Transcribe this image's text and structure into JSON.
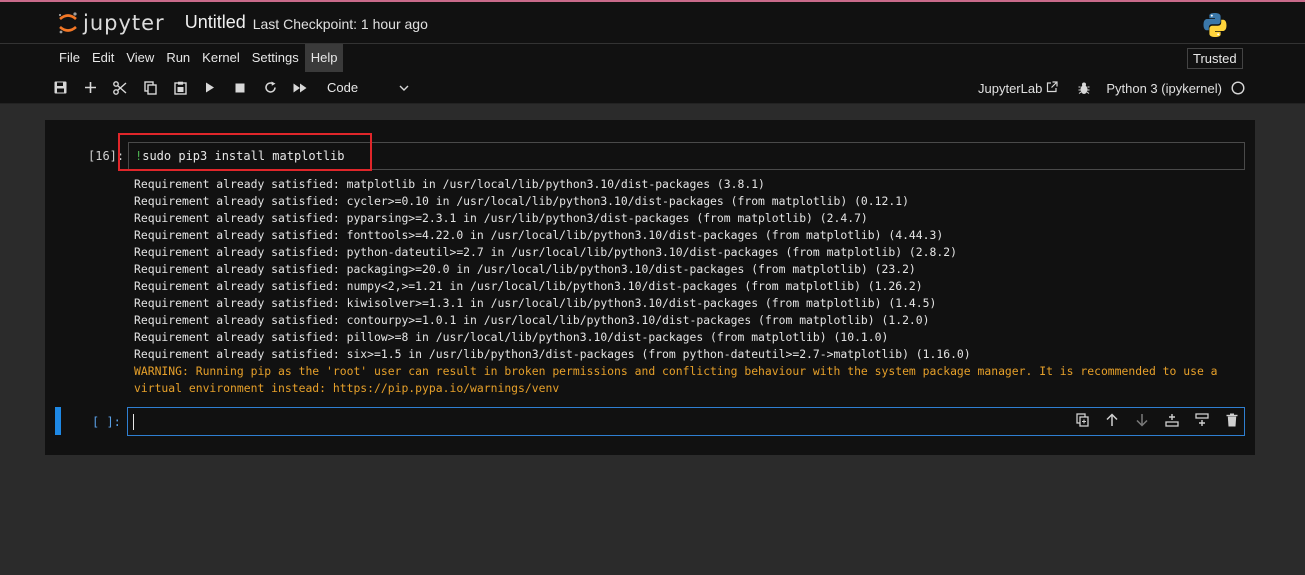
{
  "header": {
    "logo_text": "jupyter",
    "notebook_title": "Untitled",
    "checkpoint": "Last Checkpoint: 1 hour ago",
    "python_logo_icon": "python-logo-icon"
  },
  "menu": {
    "items": [
      "File",
      "Edit",
      "View",
      "Run",
      "Kernel",
      "Settings",
      "Help"
    ],
    "active": "Help",
    "trusted_label": "Trusted"
  },
  "toolbar": {
    "icons": [
      "save-icon",
      "add-icon",
      "cut-icon",
      "copy-icon",
      "paste-icon",
      "run-icon",
      "stop-icon",
      "restart-icon",
      "fast-forward-icon"
    ],
    "cell_type": "Code",
    "jupyterlab_label": "JupyterLab",
    "kernel_label": "Python 3 (ipykernel)",
    "kernel_status": "idle"
  },
  "cells": [
    {
      "prompt": "[16]:",
      "code_prefix": "!",
      "code_rest": "sudo pip3 install matplotlib",
      "output_lines": [
        "Requirement already satisfied: matplotlib in /usr/local/lib/python3.10/dist-packages (3.8.1)",
        "Requirement already satisfied: cycler>=0.10 in /usr/local/lib/python3.10/dist-packages (from matplotlib) (0.12.1)",
        "Requirement already satisfied: pyparsing>=2.3.1 in /usr/lib/python3/dist-packages (from matplotlib) (2.4.7)",
        "Requirement already satisfied: fonttools>=4.22.0 in /usr/local/lib/python3.10/dist-packages (from matplotlib) (4.44.3)",
        "Requirement already satisfied: python-dateutil>=2.7 in /usr/local/lib/python3.10/dist-packages (from matplotlib) (2.8.2)",
        "Requirement already satisfied: packaging>=20.0 in /usr/local/lib/python3.10/dist-packages (from matplotlib) (23.2)",
        "Requirement already satisfied: numpy<2,>=1.21 in /usr/local/lib/python3.10/dist-packages (from matplotlib) (1.26.2)",
        "Requirement already satisfied: kiwisolver>=1.3.1 in /usr/local/lib/python3.10/dist-packages (from matplotlib) (1.4.5)",
        "Requirement already satisfied: contourpy>=1.0.1 in /usr/local/lib/python3.10/dist-packages (from matplotlib) (1.2.0)",
        "Requirement already satisfied: pillow>=8 in /usr/local/lib/python3.10/dist-packages (from matplotlib) (10.1.0)",
        "Requirement already satisfied: six>=1.5 in /usr/lib/python3/dist-packages (from python-dateutil>=2.7->matplotlib) (1.16.0)"
      ],
      "warning_lines": [
        "WARNING: Running pip as the 'root' user can result in broken permissions and conflicting behaviour with the system package manager. It is recommended to use a",
        "virtual environment instead: https://pip.pypa.io/warnings/venv"
      ]
    },
    {
      "prompt": "[ ]:",
      "code": ""
    }
  ],
  "cell_toolbar": {
    "icons": [
      "duplicate-icon",
      "move-up-icon",
      "move-down-icon",
      "insert-above-icon",
      "insert-below-icon",
      "delete-icon"
    ]
  },
  "colors": {
    "accent": "#1e88e5",
    "highlight": "#e0262a",
    "warning": "#e6a02a",
    "bang": "#4caf50"
  }
}
